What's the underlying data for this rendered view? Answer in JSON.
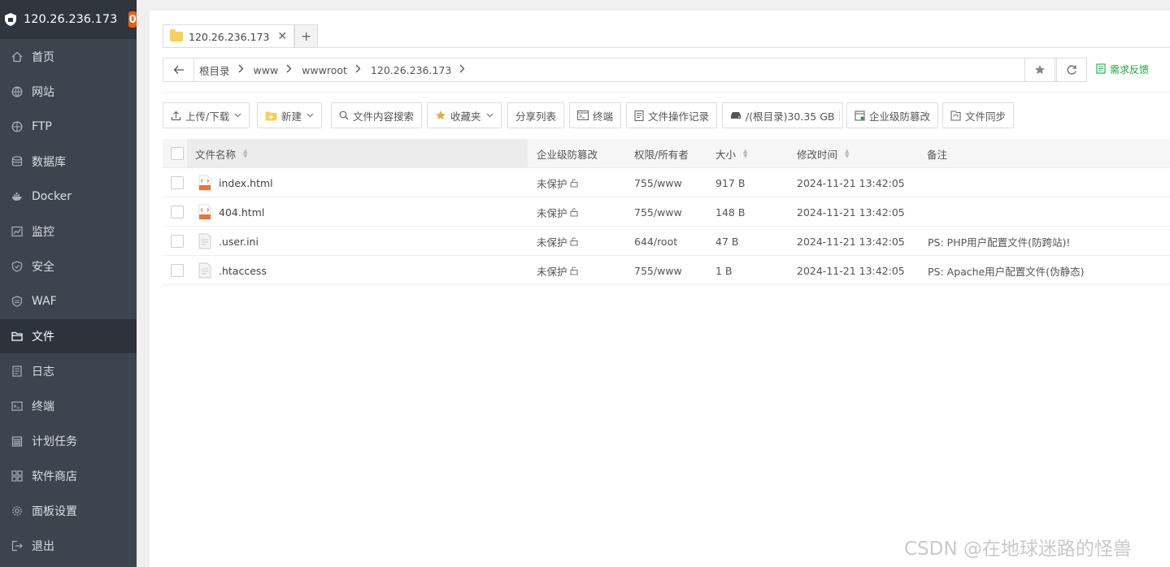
{
  "sidebar": {
    "server_ip": "120.26.236.173",
    "badge_count": "0",
    "items": [
      {
        "label": "首页",
        "icon": "home-icon"
      },
      {
        "label": "网站",
        "icon": "globe-icon"
      },
      {
        "label": "FTP",
        "icon": "ftp-icon"
      },
      {
        "label": "数据库",
        "icon": "database-icon"
      },
      {
        "label": "Docker",
        "icon": "docker-icon"
      },
      {
        "label": "监控",
        "icon": "monitor-icon"
      },
      {
        "label": "安全",
        "icon": "shield-icon"
      },
      {
        "label": "WAF",
        "icon": "waf-icon"
      },
      {
        "label": "文件",
        "icon": "folder-icon",
        "active": true
      },
      {
        "label": "日志",
        "icon": "log-icon"
      },
      {
        "label": "终端",
        "icon": "terminal-icon"
      },
      {
        "label": "计划任务",
        "icon": "calendar-icon"
      },
      {
        "label": "软件商店",
        "icon": "apps-icon"
      },
      {
        "label": "面板设置",
        "icon": "gear-icon"
      },
      {
        "label": "退出",
        "icon": "logout-icon"
      }
    ]
  },
  "tabs": [
    {
      "label": "120.26.236.173"
    }
  ],
  "breadcrumb": [
    "根目录",
    "www",
    "wwwroot",
    "120.26.236.173"
  ],
  "feedback_label": "需求反馈",
  "toolbar": {
    "upload_download": "上传/下载",
    "new": "新建",
    "content_search": "文件内容搜索",
    "favorites": "收藏夹",
    "share_list": "分享列表",
    "terminal": "终端",
    "operation_log": "文件操作记录",
    "disk": "/(根目录)30.35 GB",
    "tamper_proof": "企业级防篡改",
    "file_sync": "文件同步"
  },
  "table": {
    "headers": {
      "name": "文件名称",
      "protect": "企业级防篡改",
      "perm": "权限/所有者",
      "size": "大小",
      "mtime": "修改时间",
      "note": "备注"
    },
    "rows": [
      {
        "name": "index.html",
        "type": "html",
        "protect": "未保护",
        "perm": "755/www",
        "size": "917 B",
        "mtime": "2024-11-21 13:42:05",
        "note": ""
      },
      {
        "name": "404.html",
        "type": "html",
        "protect": "未保护",
        "perm": "755/www",
        "size": "148 B",
        "mtime": "2024-11-21 13:42:05",
        "note": ""
      },
      {
        "name": ".user.ini",
        "type": "text",
        "protect": "未保护",
        "perm": "644/root",
        "size": "47 B",
        "mtime": "2024-11-21 13:42:05",
        "note": "PS: PHP用户配置文件(防跨站)!"
      },
      {
        "name": ".htaccess",
        "type": "text",
        "protect": "未保护",
        "perm": "755/www",
        "size": "1 B",
        "mtime": "2024-11-21 13:42:05",
        "note": "PS: Apache用户配置文件(伪静态)"
      }
    ]
  },
  "watermark": "CSDN @在地球迷路的怪兽",
  "colors": {
    "sidebar_bg": "#3c444d",
    "sidebar_active": "#2d333a",
    "badge": "#f25d0f",
    "accent_green": "#20a53a",
    "folder_yellow": "#f9cf5b"
  }
}
